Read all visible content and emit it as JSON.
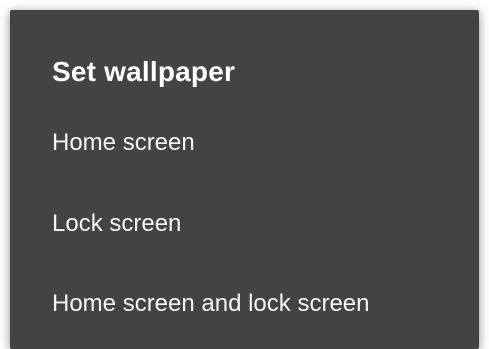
{
  "dialog": {
    "title": "Set wallpaper",
    "options": [
      {
        "label": "Home screen"
      },
      {
        "label": "Lock screen"
      },
      {
        "label": "Home screen and lock screen"
      }
    ]
  },
  "colors": {
    "dialog_background": "#434343",
    "text": "#ffffff",
    "page_background": "#ffffff"
  }
}
